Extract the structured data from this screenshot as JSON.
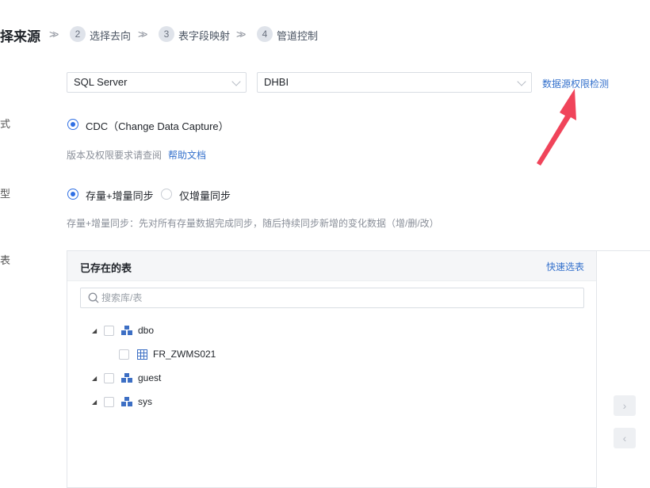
{
  "stepper": {
    "current": "择来源",
    "steps": [
      {
        "num": "2",
        "label": "选择去向"
      },
      {
        "num": "3",
        "label": "表字段映射"
      },
      {
        "num": "4",
        "label": "管道控制"
      }
    ],
    "separator": "»"
  },
  "cut_labels": [
    "式",
    "型",
    "表"
  ],
  "source": {
    "db_type": "SQL Server",
    "connection": "DHBI",
    "permission_check_link": "数据源权限检测"
  },
  "sync_mode": {
    "option_label": "CDC（Change Data Capture）",
    "hint_prefix": "版本及权限要求请查阅",
    "help_link": "帮助文档"
  },
  "sync_type": {
    "options": [
      "存量+增量同步",
      "仅增量同步"
    ],
    "selected": "存量+增量同步",
    "description": "存量+增量同步：先对所有存量数据完成同步，随后持续同步新增的变化数据（增/删/改）"
  },
  "table_panel": {
    "title": "已存在的表",
    "quick_select": "快速选表",
    "search_placeholder": "搜索库/表",
    "tree": [
      {
        "label": "dbo",
        "children": [
          "FR_ZWMS021"
        ]
      },
      {
        "label": "guest"
      },
      {
        "label": "sys"
      }
    ]
  },
  "transfer": {
    "right_arrow": "›",
    "left_arrow": "‹"
  },
  "colors": {
    "accent": "#2f6fe4",
    "link": "#3370cc",
    "annotation_arrow": "#f0445a"
  }
}
